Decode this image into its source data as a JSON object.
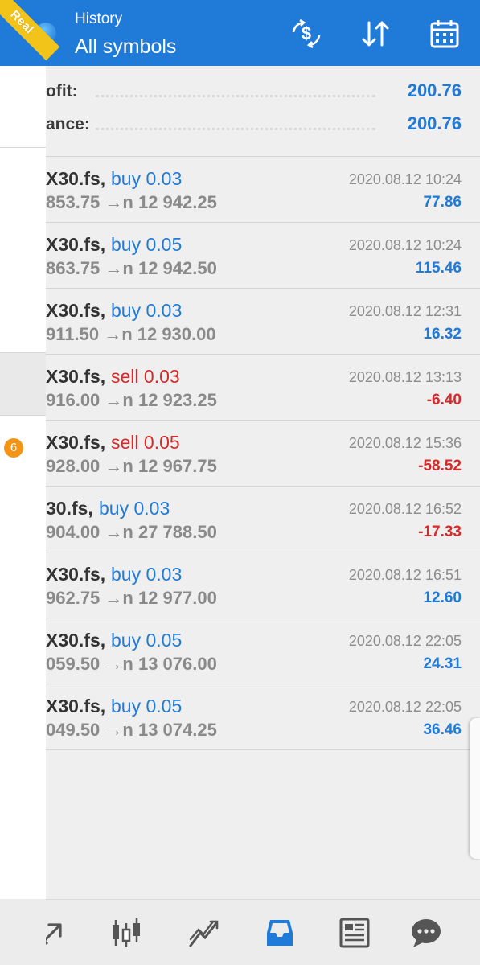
{
  "header": {
    "title": "History",
    "subtitle": "All symbols"
  },
  "drawer": {
    "account_badge": "Real",
    "notification_count": "6"
  },
  "summary": {
    "profit_label": "ofit:",
    "profit_value": "200.76",
    "balance_label": "ance:",
    "balance_value": "200.76"
  },
  "trades": [
    {
      "symbol": "X30.fs,",
      "side": "buy 0.03",
      "side_type": "buy",
      "prices": "853.75 →n  12 942.25",
      "time": "2020.08.12 10:24",
      "pl": "77.86",
      "pl_sign": "pos"
    },
    {
      "symbol": "X30.fs,",
      "side": "buy 0.05",
      "side_type": "buy",
      "prices": "863.75 →n  12 942.50",
      "time": "2020.08.12 10:24",
      "pl": "115.46",
      "pl_sign": "pos"
    },
    {
      "symbol": "X30.fs,",
      "side": "buy 0.03",
      "side_type": "buy",
      "prices": "911.50 →n  12 930.00",
      "time": "2020.08.12 12:31",
      "pl": "16.32",
      "pl_sign": "pos"
    },
    {
      "symbol": "X30.fs,",
      "side": "sell 0.03",
      "side_type": "sell",
      "prices": "916.00 →n  12 923.25",
      "time": "2020.08.12 13:13",
      "pl": "-6.40",
      "pl_sign": "neg"
    },
    {
      "symbol": "X30.fs,",
      "side": "sell 0.05",
      "side_type": "sell",
      "prices": "928.00 →n  12 967.75",
      "time": "2020.08.12 15:36",
      "pl": "-58.52",
      "pl_sign": "neg"
    },
    {
      "symbol": "30.fs,",
      "side": "buy 0.03",
      "side_type": "buy",
      "prices": "904.00 →n  27 788.50",
      "time": "2020.08.12 16:52",
      "pl": "-17.33",
      "pl_sign": "neg"
    },
    {
      "symbol": "X30.fs,",
      "side": "buy 0.03",
      "side_type": "buy",
      "prices": "962.75 →n  12 977.00",
      "time": "2020.08.12 16:51",
      "pl": "12.60",
      "pl_sign": "pos"
    },
    {
      "symbol": "X30.fs,",
      "side": "buy 0.05",
      "side_type": "buy",
      "prices": "059.50 →n  13 076.00",
      "time": "2020.08.12 22:05",
      "pl": "24.31",
      "pl_sign": "pos"
    },
    {
      "symbol": "X30.fs,",
      "side": "buy 0.05",
      "side_type": "buy",
      "prices": "049.50 →n  13 074.25",
      "time": "2020.08.12 22:05",
      "pl": "36.46",
      "pl_sign": "pos"
    }
  ],
  "icons": {
    "header": [
      "deposit-exchange-icon",
      "sort-icon",
      "calendar-icon"
    ],
    "bottom_nav": [
      "trade-arrow-icon",
      "candlestick-chart-icon",
      "trend-lines-icon",
      "history-inbox-icon",
      "news-icon",
      "chat-icon"
    ]
  },
  "colors": {
    "accent": "#1f7ad8",
    "negative": "#d42a2a",
    "badge": "#f2c318",
    "notification": "#f39414"
  }
}
